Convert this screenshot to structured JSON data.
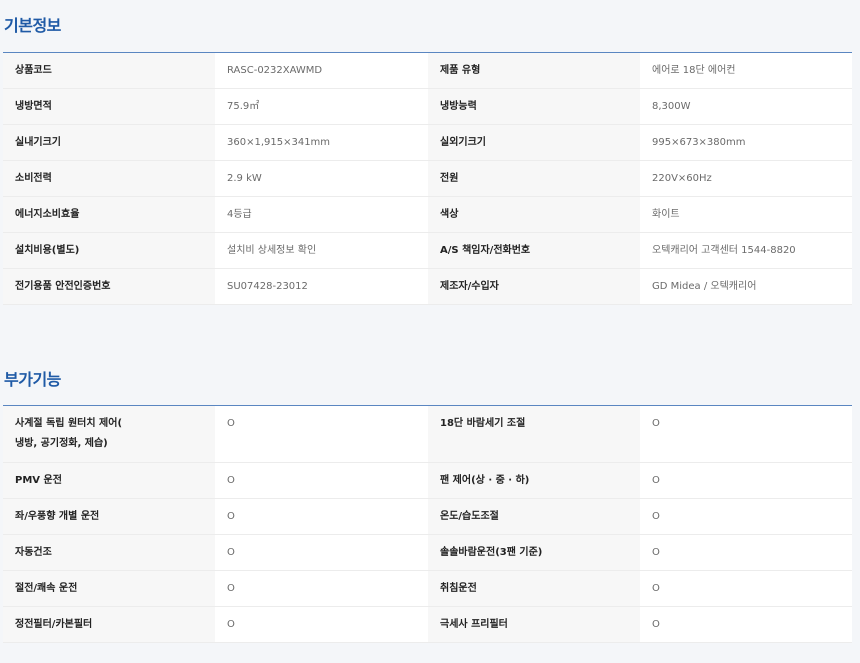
{
  "basic": {
    "title": "기본정보",
    "rows": [
      {
        "l1": "상품코드",
        "v1": "RASC-0232XAWMD",
        "l2": "제품 유형",
        "v2": "에어로 18단 에어컨"
      },
      {
        "l1": "냉방면적",
        "v1": "75.9㎡",
        "l2": "냉방능력",
        "v2": "8,300W"
      },
      {
        "l1": "실내기크기",
        "v1": "360×1,915×341mm",
        "l2": "실외기크기",
        "v2": "995×673×380mm"
      },
      {
        "l1": "소비전력",
        "v1": "2.9 kW",
        "l2": "전원",
        "v2": "220V×60Hz"
      },
      {
        "l1": "에너지소비효율",
        "v1": "4등급",
        "l2": "색상",
        "v2": "화이트"
      },
      {
        "l1": "설치비용(별도)",
        "v1": "설치비 상세정보 확인",
        "l2": "A/S 책임자/전화번호",
        "v2": "오텍캐리어 고객센터 1544-8820"
      },
      {
        "l1": "전기용품 안전인증번호",
        "v1": "SU07428-23012",
        "l2": "제조자/수입자",
        "v2": "GD Midea / 오텍캐리어"
      }
    ]
  },
  "extra": {
    "title": "부가기능",
    "rows": [
      {
        "l1": "사계절 독립 원터치 제어(\n냉방, 공기정화, 제습)",
        "v1": "O",
        "l2": "18단 바람세기 조절",
        "v2": "O"
      },
      {
        "l1": "PMV 운전",
        "v1": "O",
        "l2": "팬 제어(상 · 중 · 하)",
        "v2": "O"
      },
      {
        "l1": "좌/우풍향 개별 운전",
        "v1": "O",
        "l2": "온도/습도조절",
        "v2": "O"
      },
      {
        "l1": "자동건조",
        "v1": "O",
        "l2": "솔솔바람운전(3팬 기준)",
        "v2": "O"
      },
      {
        "l1": "절전/쾌속 운전",
        "v1": "O",
        "l2": "취침운전",
        "v2": "O"
      },
      {
        "l1": "정전필터/카본필터",
        "v1": "O",
        "l2": "극세사 프리필터",
        "v2": "O"
      }
    ]
  }
}
